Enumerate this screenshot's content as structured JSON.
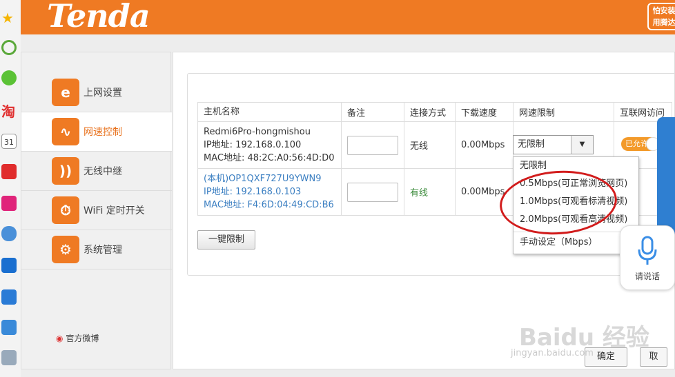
{
  "header": {
    "logo": "Tenda",
    "badge_line1": "怕安装",
    "badge_line2": "用腾达"
  },
  "sidebar": {
    "items": [
      {
        "label": "上网设置",
        "icon": "e"
      },
      {
        "label": "网速控制",
        "icon": "∿"
      },
      {
        "label": "无线中继",
        "icon": "))"
      },
      {
        "label": "WiFi 定时开关",
        "icon": "⏱"
      },
      {
        "label": "系统管理",
        "icon": "⚙"
      }
    ],
    "weibo": "官方微博"
  },
  "table": {
    "headers": [
      "主机名称",
      "备注",
      "连接方式",
      "下载速度",
      "网速限制",
      "互联网访问"
    ],
    "rows": [
      {
        "name": "Redmi6Pro-hongmishou",
        "ip": "IP地址: 192.168.0.100",
        "mac": "MAC地址: 48:2C:A0:56:4D:D0",
        "conn": "无线",
        "speed": "0.00Mbps",
        "limit": "无限制",
        "access": "已允许"
      },
      {
        "name": "(本机)OP1QXF727U9YWN9",
        "ip": "IP地址: 192.168.0.103",
        "mac": "MAC地址: F4:6D:04:49:CD:B6",
        "conn": "有线",
        "speed": "0.00Mbps"
      }
    ]
  },
  "buttons": {
    "limit_all": "一键限制",
    "ok": "确定",
    "cancel": "取"
  },
  "dropdown": {
    "options": [
      "无限制",
      "0.5Mbps(可正常浏览网页)",
      "1.0Mbps(可观看标清视频)",
      "2.0Mbps(可观看高清视频)",
      "手动设定（Mbps）"
    ]
  },
  "voice": {
    "label": "请说话"
  },
  "watermark": {
    "text": "Baidu 经验",
    "url": "jingyan.baidu.com"
  },
  "colors": {
    "brand": "#ef7a23",
    "annotation": "#d21c1c"
  }
}
